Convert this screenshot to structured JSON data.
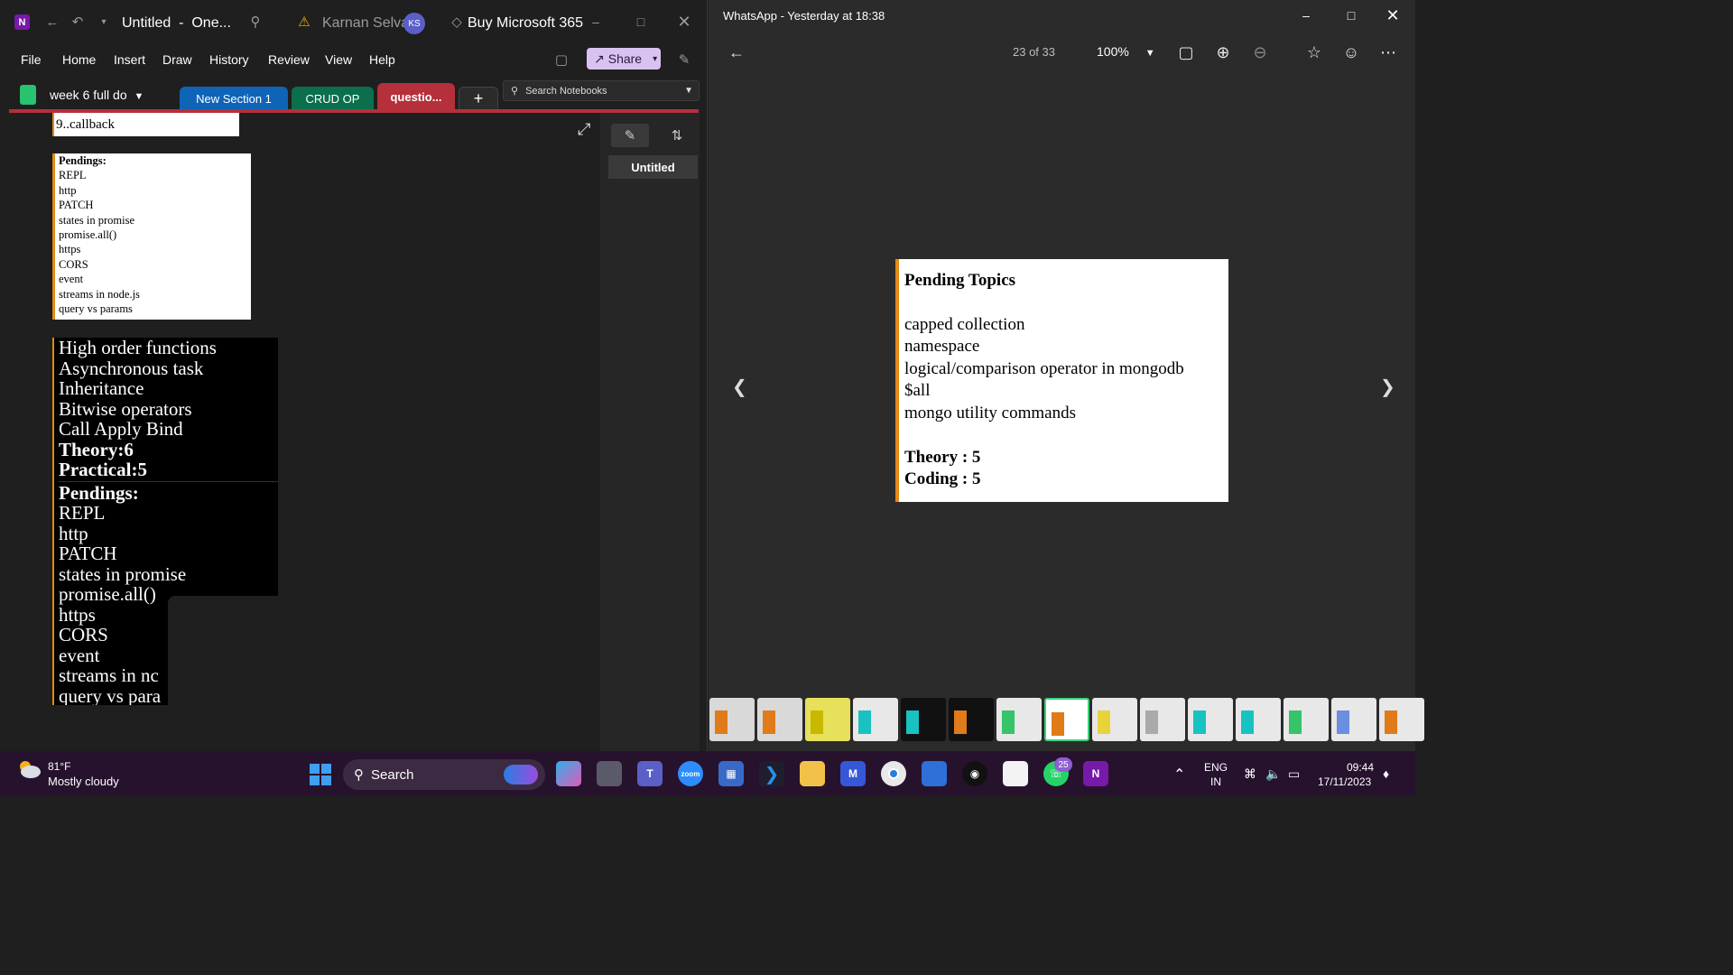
{
  "onenote": {
    "title": "Untitled",
    "app_suffix": "One...",
    "user_name": "Karnan Selvam",
    "user_initials": "KS",
    "buy_label": "Buy Microsoft 365",
    "menu": [
      "File",
      "Home",
      "Insert",
      "Draw",
      "History",
      "Review",
      "View",
      "Help"
    ],
    "share_label": "Share",
    "notebook_name": "week 6 full do",
    "sections": [
      {
        "label": "New Section 1",
        "color": "#0f64b8"
      },
      {
        "label": "CRUD OP",
        "color": "#0b6f4d"
      },
      {
        "label": "questio...",
        "color": "#b5303b"
      }
    ],
    "add_section": "+",
    "search_placeholder": "Search Notebooks",
    "page_list": {
      "pages": [
        "Untitled"
      ]
    },
    "content": {
      "callback_text": "9..callback",
      "small_pendings": {
        "heading": "Pendings:",
        "items": [
          "REPL",
          "http",
          "PATCH",
          "states in promise",
          "promise.all()",
          "https",
          "CORS",
          "event",
          "streams in node.js",
          "query vs params"
        ]
      },
      "black_block": {
        "topics": [
          "High order functions",
          "Asynchronous task",
          "Inheritance",
          "Bitwise operators",
          "Call Apply Bind"
        ],
        "theory": "Theory:6",
        "practical": "Practical:5",
        "pendings_heading": "Pendings:",
        "pendings": [
          "REPL",
          "http",
          "PATCH",
          "states in promise",
          "promise.all()",
          "https",
          "CORS",
          "event",
          "streams in nc",
          "query vs para"
        ]
      }
    }
  },
  "viewer": {
    "title": "WhatsApp - Yesterday at 18:38",
    "counter": "23 of 33",
    "zoom": "100%",
    "image": {
      "title": "Pending Topics",
      "items": [
        "capped collection",
        "namespace",
        "logical/comparison operator in mongodb",
        "$all",
        "mongo utility commands"
      ],
      "theory": "Theory : 5",
      "coding": "Coding : 5"
    },
    "thumbnails": [
      {
        "color": "#d9d9d9",
        "accent": "#e07b1a"
      },
      {
        "color": "#d9d9d9",
        "accent": "#e07b1a"
      },
      {
        "color": "#e6e05a",
        "accent": "#c9b800"
      },
      {
        "color": "#e8e8e8",
        "accent": "#19c2c2"
      },
      {
        "color": "#111111",
        "accent": "#19c2c2"
      },
      {
        "color": "#111111",
        "accent": "#e07b1a"
      },
      {
        "color": "#e8e8e8",
        "accent": "#36c46a"
      },
      {
        "color": "#ffffff",
        "accent": "#e07b1a"
      },
      {
        "color": "#e8e8e8",
        "accent": "#e6d43a"
      },
      {
        "color": "#e8e8e8",
        "accent": "#aaaaaa"
      },
      {
        "color": "#e8e8e8",
        "accent": "#19c2c2"
      },
      {
        "color": "#e8e8e8",
        "accent": "#19c2c2"
      },
      {
        "color": "#e8e8e8",
        "accent": "#36c46a"
      },
      {
        "color": "#e8e8e8",
        "accent": "#6a8fe0"
      },
      {
        "color": "#e8e8e8",
        "accent": "#e07b1a"
      }
    ]
  },
  "taskbar": {
    "temperature": "81°F",
    "weather_desc": "Mostly cloudy",
    "search_label": "Search",
    "whatsapp_badge": "25",
    "lang_top": "ENG",
    "lang_bottom": "IN",
    "time": "09:44",
    "date": "17/11/2023"
  }
}
